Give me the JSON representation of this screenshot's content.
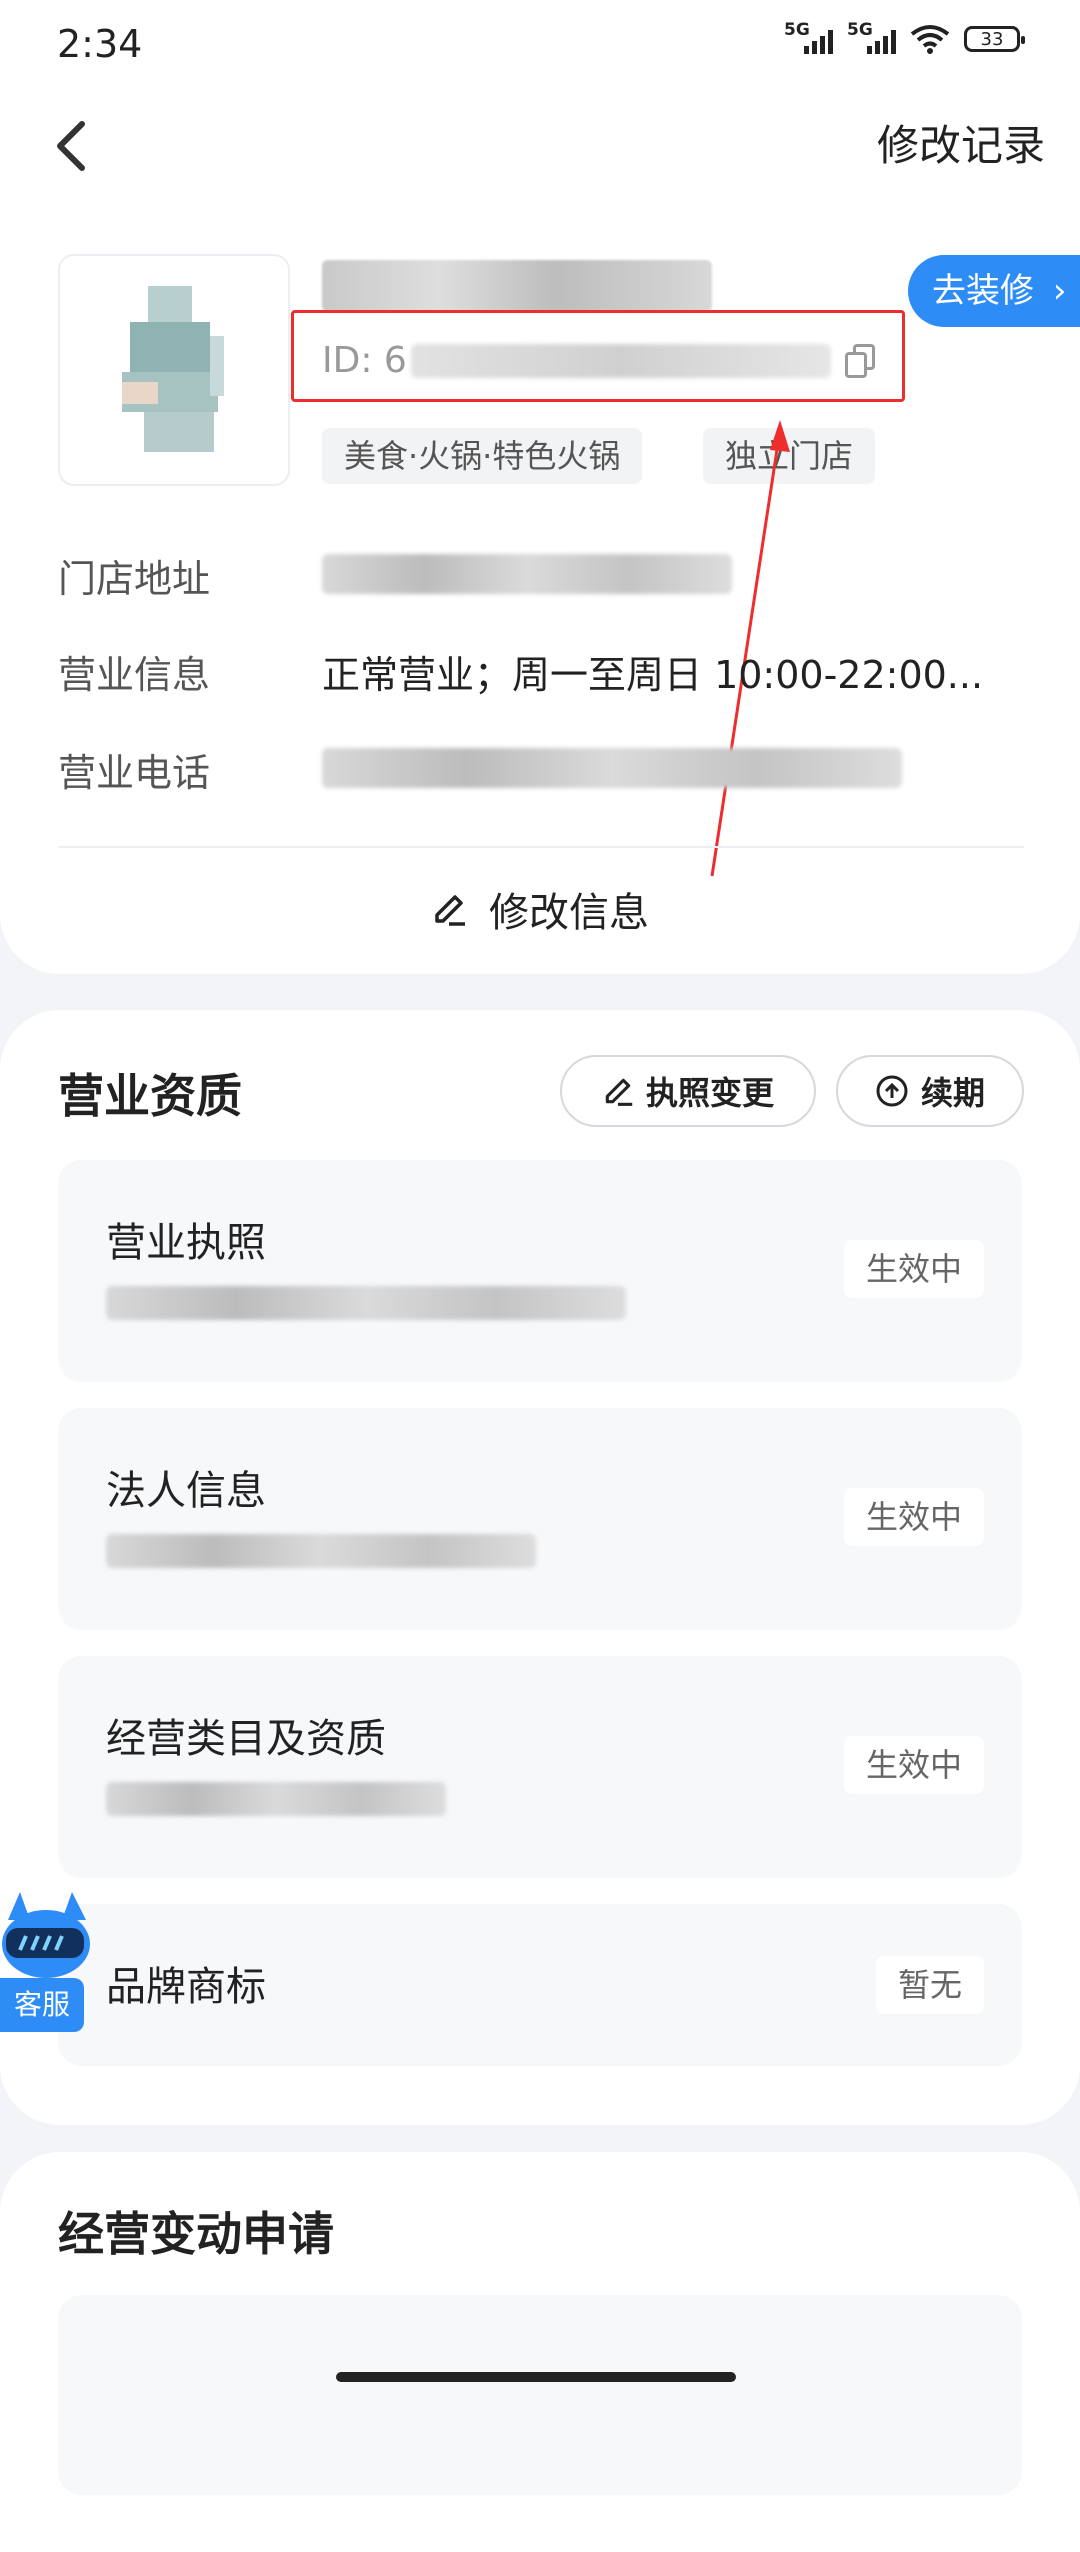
{
  "status_bar": {
    "time": "2:34",
    "signal1": "5G",
    "signal2": "5G",
    "battery": "33"
  },
  "header": {
    "history_link": "修改记录"
  },
  "store": {
    "id_prefix": "ID: 6",
    "tags": [
      "美食·火锅·特色火锅",
      "独立门店"
    ],
    "decorate_button": "去装修",
    "info": [
      {
        "label": "门店地址",
        "value": ""
      },
      {
        "label": "营业信息",
        "value": "正常营业；周一至周日 10:00-22:00..."
      },
      {
        "label": "营业电话",
        "value": ""
      }
    ],
    "edit_button": "修改信息"
  },
  "qualification": {
    "title": "营业资质",
    "change_license_button": "执照变更",
    "renew_button": "续期",
    "items": [
      {
        "title": "营业执照",
        "status": "生效中"
      },
      {
        "title": "法人信息",
        "status": "生效中"
      },
      {
        "title": "经营类目及资质",
        "status": "生效中"
      },
      {
        "title": "品牌商标",
        "status": "暂无"
      }
    ]
  },
  "change_requests": {
    "title": "经营变动申请"
  },
  "service": {
    "label": "客服"
  },
  "colors": {
    "accent": "#2d8cf5",
    "highlight": "#ee2d2d",
    "bg": "#f3f4f8"
  }
}
